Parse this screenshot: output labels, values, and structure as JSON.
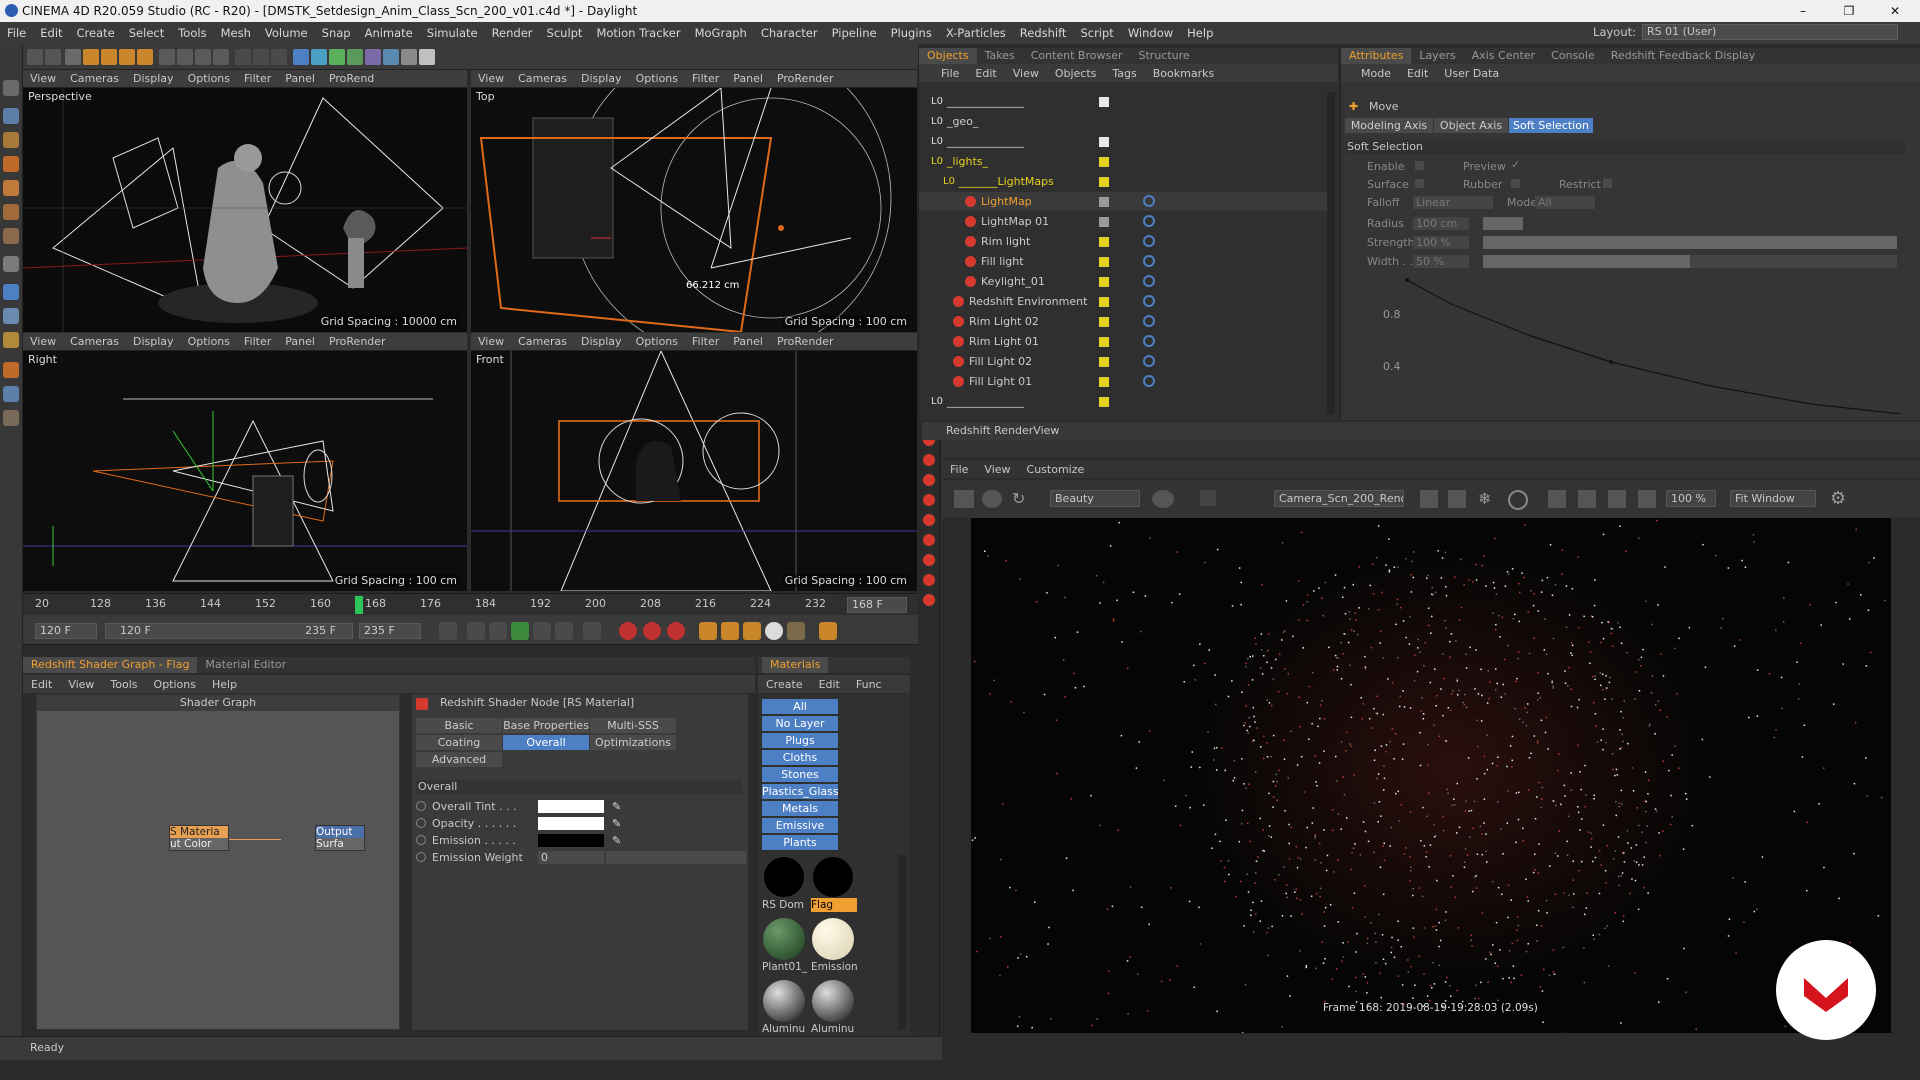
{
  "window": {
    "title": "CINEMA 4D R20.059 Studio (RC - R20) - [DMSTK_Setdesign_Anim_Class_Scn_200_v01.c4d *] - Daylight"
  },
  "menubar": [
    "File",
    "Edit",
    "Create",
    "Select",
    "Tools",
    "Mesh",
    "Volume",
    "Snap",
    "Animate",
    "Simulate",
    "Render",
    "Sculpt",
    "Motion Tracker",
    "MoGraph",
    "Character",
    "Pipeline",
    "Plugins",
    "X-Particles",
    "Redshift",
    "Script",
    "Window",
    "Help"
  ],
  "layout": {
    "label": "Layout:",
    "value": "RS 01 (User)"
  },
  "viewport_menu": [
    "View",
    "Cameras",
    "Display",
    "Options",
    "Filter",
    "Panel",
    "ProRender"
  ],
  "viewport_menu_short": [
    "View",
    "Cameras",
    "Display",
    "Options",
    "Filter",
    "Panel",
    "ProRend"
  ],
  "viewports": [
    {
      "name": "Perspective",
      "grid": "Grid Spacing : 10000 cm"
    },
    {
      "name": "Top",
      "grid": "Grid Spacing : 100 cm",
      "measure": "66.212 cm"
    },
    {
      "name": "Right",
      "grid": "Grid Spacing : 100 cm"
    },
    {
      "name": "Front",
      "grid": "Grid Spacing : 100 cm"
    }
  ],
  "timeline": {
    "ticks": [
      "20",
      "128",
      "136",
      "144",
      "152",
      "160",
      "168",
      "176",
      "184",
      "192",
      "200",
      "208",
      "216",
      "224",
      "232"
    ],
    "current": "168 F",
    "playhead": 168,
    "range_start": 120,
    "range_end": 235
  },
  "transport": {
    "start": "120 F",
    "range_left": "120 F",
    "range_right": "235 F",
    "end": "235 F"
  },
  "shader_panel": {
    "tabs": [
      "Redshift Shader Graph - Flag",
      "Material Editor"
    ],
    "menu": [
      "Edit",
      "View",
      "Tools",
      "Options",
      "Help"
    ],
    "graph_title": "Shader Graph",
    "node1_title": "S Materia",
    "node1_port": "ut Color",
    "node2_title": "Output",
    "node2_port": "Surfa"
  },
  "rs_node": {
    "title": "Redshift Shader Node [RS Material]",
    "tabs_row1": [
      "Basic",
      "Base Properties",
      "Multi-SSS"
    ],
    "tabs_row2": [
      "Coating",
      "Overall",
      "Optimizations"
    ],
    "tabs_row3": [
      "Advanced"
    ],
    "section": "Overall",
    "props": [
      "Overall Tint . . .",
      "Opacity . . . . . .",
      "Emission . . . . .",
      "Emission Weight"
    ],
    "emission_weight": "0"
  },
  "materials": {
    "tab": "Materials",
    "menu": [
      "Create",
      "Edit",
      "Func"
    ],
    "layers": [
      "All",
      "No Layer",
      "Plugs",
      "Cloths",
      "Stones",
      "Plastics_Glass",
      "Metals",
      "Emissive",
      "Plants"
    ],
    "items": [
      "RS Dom",
      "Flag",
      "Plant01_",
      "Emission",
      "Aluminu",
      "Aluminu"
    ]
  },
  "status": "Ready",
  "objects_panel": {
    "tabs": [
      "Objects",
      "Takes",
      "Content Browser",
      "Structure"
    ],
    "menu": [
      "File",
      "Edit",
      "View",
      "Objects",
      "Tags",
      "Bookmarks"
    ],
    "rows": [
      {
        "label": "______________",
        "type": "null",
        "color": "#e8e8e8"
      },
      {
        "label": "_geo_",
        "type": "null",
        "color": "none"
      },
      {
        "label": "______________",
        "type": "null",
        "color": "#e8e8e8"
      },
      {
        "label": "_lights_",
        "type": "null-orange",
        "color": "#e6d21e"
      },
      {
        "label": "_______LightMaps",
        "type": "null-orange",
        "color": "#e6d21e"
      },
      {
        "label": "LightMap",
        "type": "light",
        "color": "#9a9a9a",
        "selected": true
      },
      {
        "label": "LightMap 01",
        "type": "light",
        "color": "#9a9a9a"
      },
      {
        "label": "Rim light",
        "type": "light",
        "color": "#e6d21e"
      },
      {
        "label": "Fill light",
        "type": "light",
        "color": "#e6d21e"
      },
      {
        "label": "Keylight_01",
        "type": "light",
        "color": "#e6d21e"
      },
      {
        "label": "Redshift Environment",
        "type": "light",
        "color": "#e6d21e"
      },
      {
        "label": "Rim Light 02",
        "type": "light",
        "color": "#e6d21e"
      },
      {
        "label": "Rim Light 01",
        "type": "light",
        "color": "#e6d21e"
      },
      {
        "label": "Fill Light 02",
        "type": "light",
        "color": "#e6d21e"
      },
      {
        "label": "Fill Light 01",
        "type": "light",
        "color": "#e6d21e"
      },
      {
        "label": "______________",
        "type": "null",
        "color": "#e6d21e"
      }
    ]
  },
  "attributes_panel": {
    "tabs": [
      "Attributes",
      "Layers",
      "Axis Center",
      "Console",
      "Redshift Feedback Display"
    ],
    "menu": [
      "Mode",
      "Edit",
      "User Data"
    ],
    "tool": "Move",
    "subtabs": [
      "Modeling Axis",
      "Object Axis",
      "Soft Selection"
    ],
    "section": "Soft Selection",
    "enable": "Enable",
    "preview": "Preview",
    "surface": "Surface",
    "rubber": "Rubber",
    "restrict": "Restrict",
    "falloff_label": "Falloff",
    "falloff": "Linear",
    "mode_label": "Mode",
    "mode": "All",
    "radius_label": "Radius",
    "radius": "100 cm",
    "strength_label": "Strength",
    "strength": "100 %",
    "width_label": "Width . .",
    "width": "50 %",
    "width_fraction": 0.5,
    "graph_ticks": [
      "0.8",
      "0.4"
    ]
  },
  "renderview": {
    "title": "Redshift RenderView",
    "menu": [
      "File",
      "View",
      "Customize"
    ],
    "aov": "Beauty",
    "camera": "Camera_Scn_200_Rende",
    "zoom": "100 %",
    "fit": "Fit Window",
    "frame_info": "Frame  168:  2019-08-19  19:28:03  (2.09s)"
  },
  "colors": {
    "accent": "#f0a030",
    "select": "#4d7fc4",
    "light_red": "#d63a2e"
  }
}
